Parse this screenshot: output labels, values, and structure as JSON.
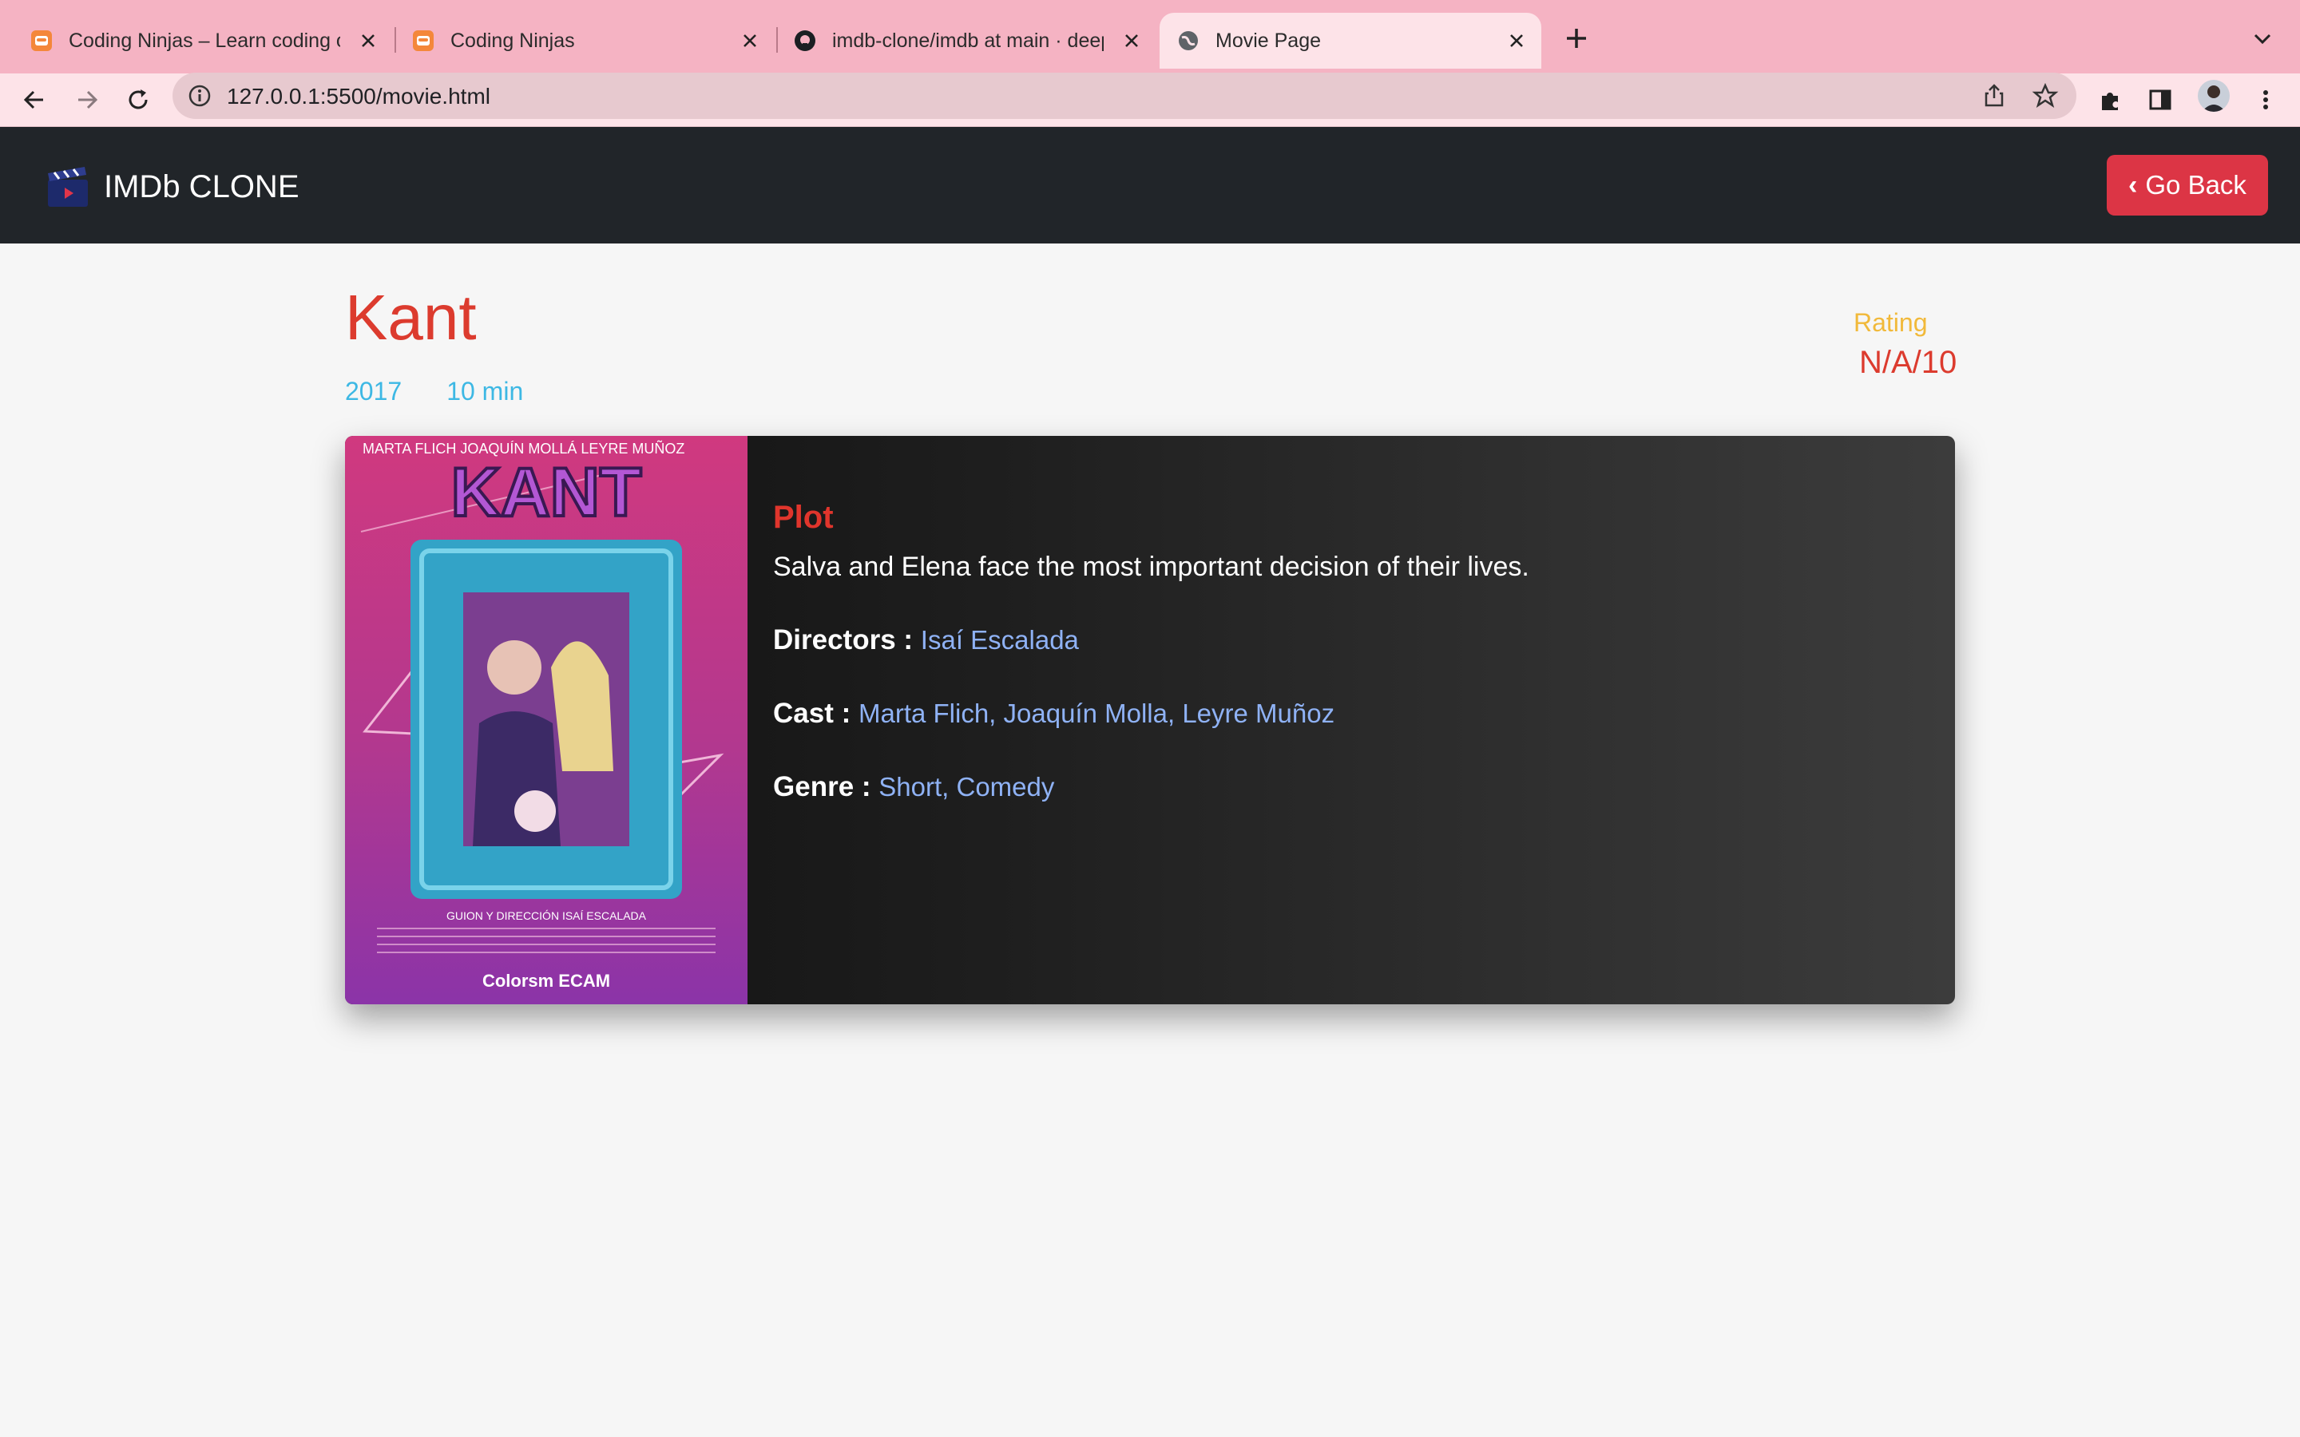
{
  "browser": {
    "tabs": [
      {
        "title": "Coding Ninjas – Learn coding online at India's best coding institute",
        "active": false,
        "favicon": "coding-ninjas-icon"
      },
      {
        "title": "Coding Ninjas",
        "active": false,
        "favicon": "coding-ninjas-icon"
      },
      {
        "title": "imdb-clone/imdb at main · deepakrakhi",
        "active": false,
        "favicon": "github-icon"
      },
      {
        "title": "Movie Page",
        "active": true,
        "favicon": "globe-icon"
      }
    ],
    "url": "127.0.0.1:5500/movie.html"
  },
  "navbar": {
    "brand": "IMDb CLONE",
    "back_label": "Go Back"
  },
  "movie": {
    "title": "Kant",
    "year": "2017",
    "runtime": "10 min",
    "rating_label": "Rating",
    "rating_value": "N/A/10",
    "plot_heading": "Plot",
    "plot": "Salva and Elena face the most important decision of their lives.",
    "directors_label": "Directors :",
    "directors": "Isaí Escalada",
    "cast_label": "Cast :",
    "cast": "Marta Flich, Joaquín Molla, Leyre Muñoz",
    "genre_label": "Genre :",
    "genre": "Short, Comedy",
    "poster": {
      "top_names": "MARTA FLICH   JOAQUÍN MOLLÁ   LEYRE MUÑOZ",
      "title": "KANT",
      "credit": "GUION Y DIRECCIÓN ISAÍ ESCALADA",
      "logos": "Colorsm   ECAM"
    }
  },
  "colors": {
    "title": "#dc3b2e",
    "meta": "#3db8e4",
    "rating_label": "#f1b93a",
    "link": "#8fb2f5",
    "button": "#dc3545",
    "navbar": "#212529",
    "chrome_tabstrip": "#f5b3c3"
  }
}
